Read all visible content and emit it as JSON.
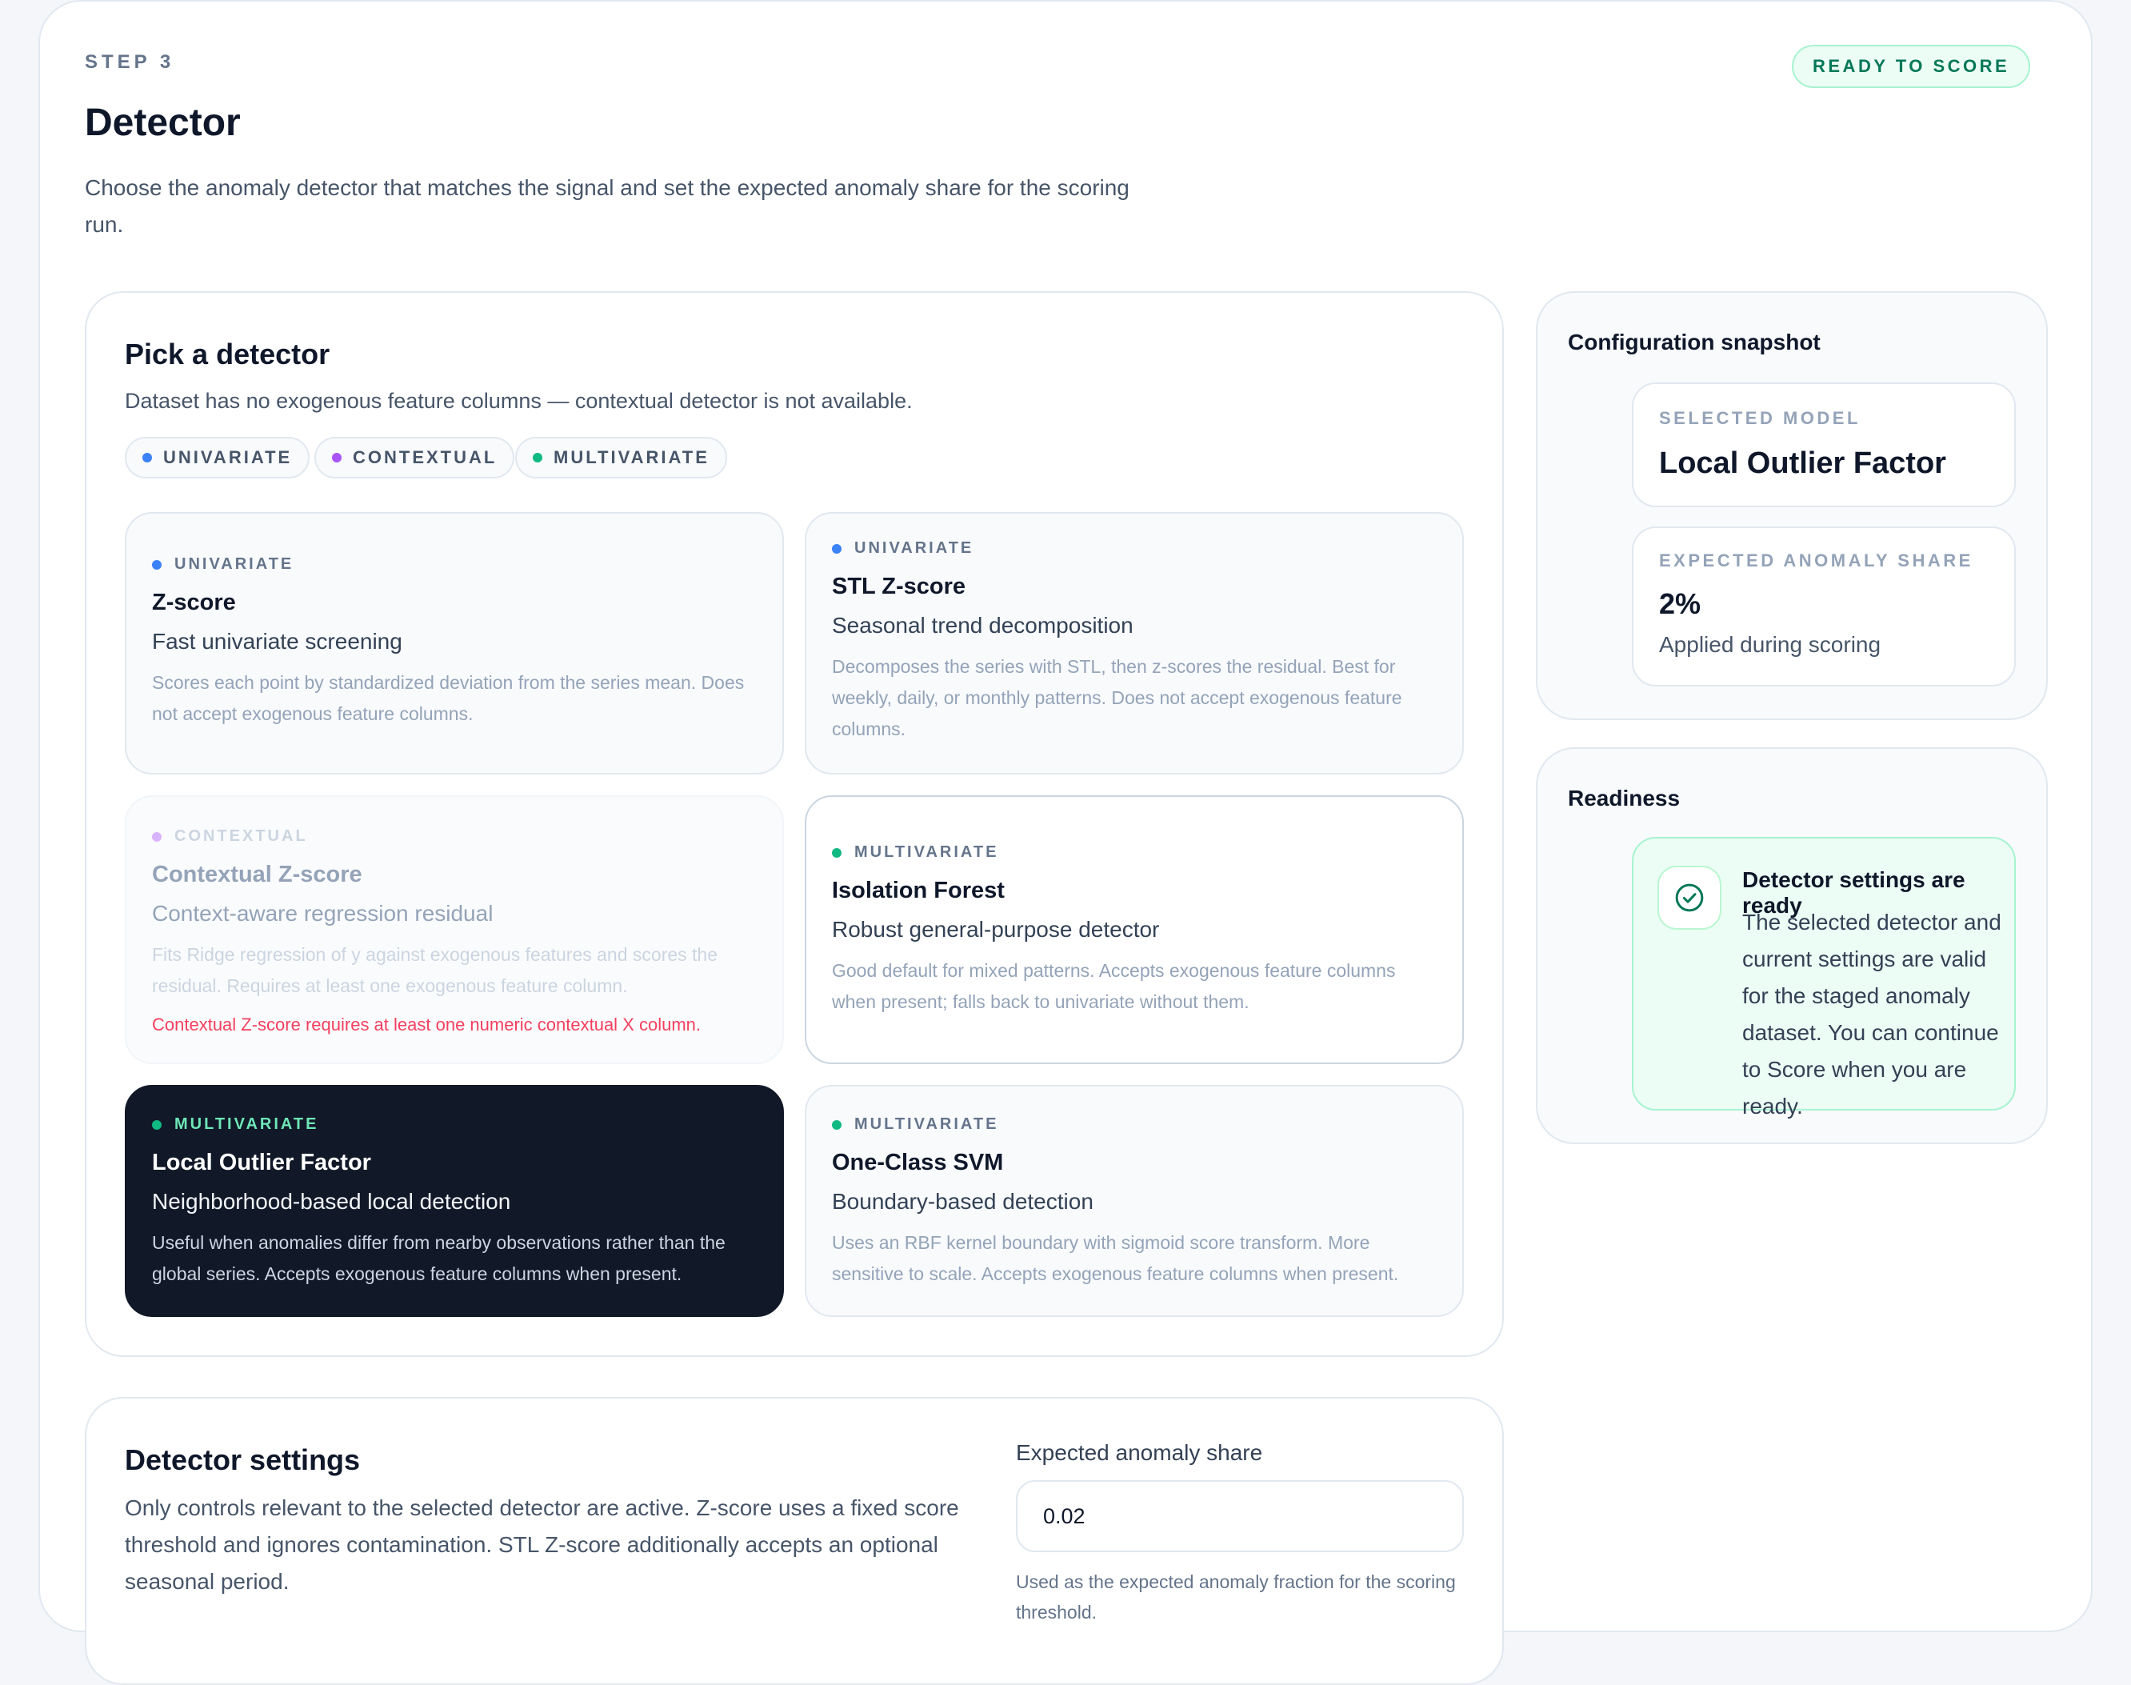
{
  "header": {
    "step": "STEP 3",
    "title": "Detector",
    "description": "Choose the anomaly detector that matches the signal and set the expected anomaly share for the scoring run.",
    "status": "READY TO SCORE"
  },
  "picker": {
    "title": "Pick a detector",
    "subtitle": "Dataset has no exogenous feature columns — contextual detector is not available.",
    "legend": [
      {
        "label": "UNIVARIATE",
        "color": "#3b82f6"
      },
      {
        "label": "CONTEXTUAL",
        "color": "#a855f7"
      },
      {
        "label": "MULTIVARIATE",
        "color": "#10b981"
      }
    ],
    "cards": [
      {
        "tag": "UNIVARIATE",
        "name": "Z-score",
        "subtitle": "Fast univariate screening",
        "body": "Scores each point by standardized deviation from the series mean. Does not accept exogenous feature columns.",
        "state": "default"
      },
      {
        "tag": "UNIVARIATE",
        "name": "STL Z-score",
        "subtitle": "Seasonal trend decomposition",
        "body": "Decomposes the series with STL, then z-scores the residual. Best for weekly, daily, or monthly patterns. Does not accept exogenous feature columns.",
        "state": "default"
      },
      {
        "tag": "CONTEXTUAL",
        "name": "Contextual Z-score",
        "subtitle": "Context-aware regression residual",
        "body": "Fits Ridge regression of y against exogenous features and scores the residual. Requires at least one exogenous feature column.",
        "error": "Contextual Z-score requires at least one numeric contextual X column.",
        "state": "disabled"
      },
      {
        "tag": "MULTIVARIATE",
        "name": "Isolation Forest",
        "subtitle": "Robust general-purpose detector",
        "body": "Good default for mixed patterns. Accepts exogenous feature columns when present; falls back to univariate without them.",
        "state": "outlined"
      },
      {
        "tag": "MULTIVARIATE",
        "name": "Local Outlier Factor",
        "subtitle": "Neighborhood-based local detection",
        "body": "Useful when anomalies differ from nearby observations rather than the global series. Accepts exogenous feature columns when present.",
        "state": "selected"
      },
      {
        "tag": "MULTIVARIATE",
        "name": "One-Class SVM",
        "subtitle": "Boundary-based detection",
        "body": "Uses an RBF kernel boundary with sigmoid score transform. More sensitive to scale. Accepts exogenous feature columns when present.",
        "state": "default"
      }
    ]
  },
  "snapshot": {
    "title": "Configuration snapshot",
    "model_label": "SELECTED MODEL",
    "model_value": "Local Outlier Factor",
    "share_label": "EXPECTED ANOMALY SHARE",
    "share_value": "2%",
    "share_note": "Applied during scoring"
  },
  "readiness": {
    "title": "Readiness",
    "status_title": "Detector settings are ready",
    "status_text": "The selected detector and current settings are valid for the staged anomaly dataset. You can continue to Score when you are ready.",
    "icon": "check-circle-icon"
  },
  "settings": {
    "title": "Detector settings",
    "description": "Only controls relevant to the selected detector are active. Z-score uses a fixed score threshold and ignores contamination. STL Z-score additionally accepts an optional seasonal period.",
    "share_field": {
      "label": "Expected anomaly share",
      "value": "0.02",
      "help": "Used as the expected anomaly fraction for the scoring threshold."
    }
  },
  "colors": {
    "univariate": "#3b82f6",
    "contextual": "#a855f7",
    "multivariate": "#10b981",
    "selected_bg": "#111827",
    "ready_bg": "#ecfdf5"
  }
}
